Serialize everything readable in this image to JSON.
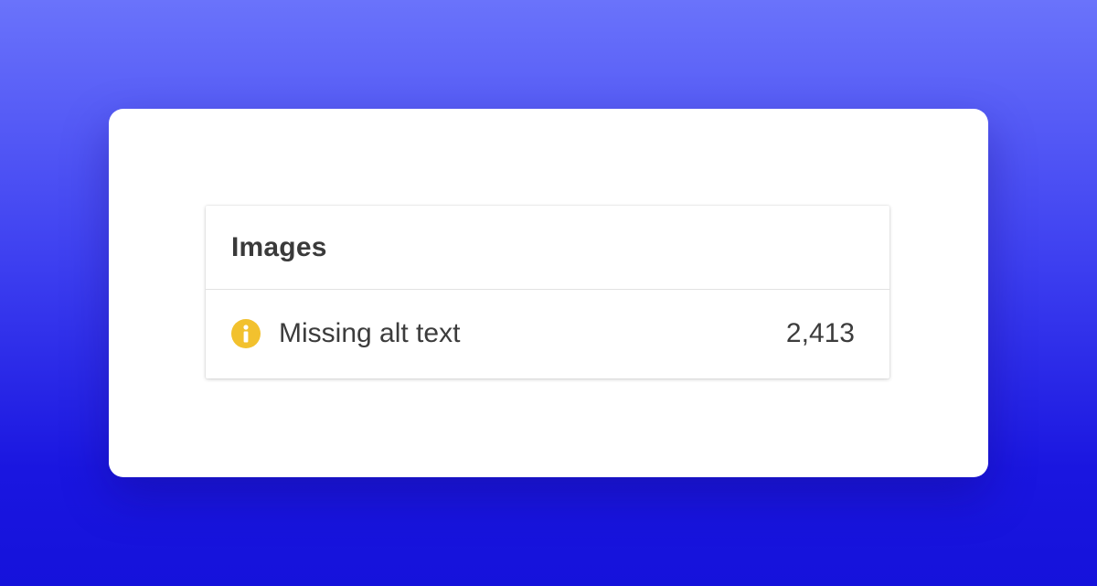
{
  "panel": {
    "title": "Images",
    "rows": [
      {
        "icon": "info-icon",
        "icon_color": "#F2C12E",
        "label": "Missing alt text",
        "value": "2,413"
      }
    ]
  },
  "colors": {
    "background_top": "#6A73FB",
    "background_bottom": "#1512DB",
    "card": "#FFFFFF",
    "warning": "#F2C12E",
    "text": "#3C3C3C"
  }
}
